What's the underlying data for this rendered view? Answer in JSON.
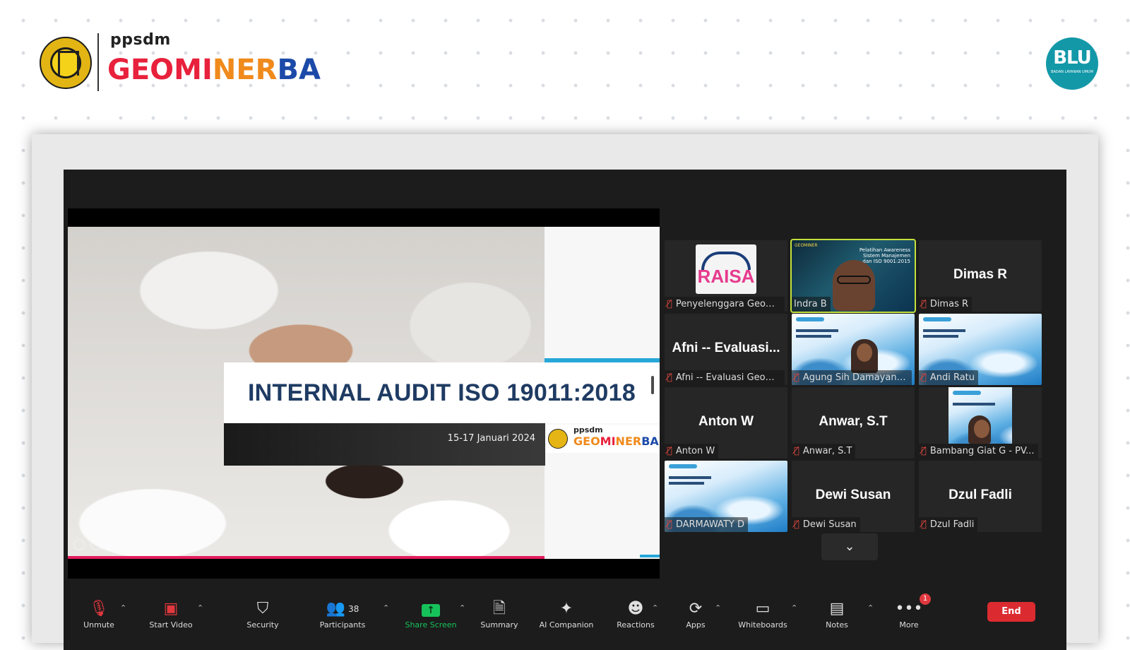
{
  "branding": {
    "brand_top": "ppsdm",
    "brand_main": {
      "geo": "GEO",
      "mi": "MI",
      "ner": "NER",
      "ba": "BA"
    },
    "badge_text": "BLU",
    "badge_sub": "BADAN LAYANAN UMUM"
  },
  "slide": {
    "title": "INTERNAL AUDIT  ISO 19011:2018",
    "date": "15-17 Januari 2024",
    "logo_top": "ppsdm",
    "logo_geo": "GEO",
    "logo_mi": "MI",
    "logo_ner": "NER",
    "logo_ba": "BA"
  },
  "gallery": {
    "tiles": [
      {
        "name": "Penyelenggara Geomi...",
        "center": "",
        "kind": "logo",
        "logo_text": "RAISA"
      },
      {
        "name": "Indra B",
        "center": "",
        "kind": "video",
        "active": true,
        "overlay": "Pelatihan Awareness Sistem Manajemen dan ISO 9001:2015",
        "tag": "GEOMINER"
      },
      {
        "name": "Dimas R",
        "center": "Dimas R",
        "kind": "name"
      },
      {
        "name": "Afni -- Evaluasi Geomin",
        "center": "Afni  -- Evaluasi...",
        "kind": "name"
      },
      {
        "name": "Agung Sih Damayanti-...",
        "center": "",
        "kind": "ppt-person"
      },
      {
        "name": "Andi Ratu",
        "center": "",
        "kind": "ppt"
      },
      {
        "name": "Anton W",
        "center": "Anton W",
        "kind": "name"
      },
      {
        "name": "Anwar, S.T",
        "center": "Anwar, S.T",
        "kind": "name"
      },
      {
        "name": "Bambang Giat G - PV...",
        "center": "",
        "kind": "small-ppt-person"
      },
      {
        "name": "DARMAWATY D",
        "center": "",
        "kind": "ppt"
      },
      {
        "name": "Dewi Susan",
        "center": "Dewi Susan",
        "kind": "name"
      },
      {
        "name": "Dzul Fadli",
        "center": "Dzul Fadli",
        "kind": "name"
      }
    ],
    "toggle_icon": "chevron-down-icon"
  },
  "toolbar": {
    "items": [
      {
        "id": "unmute",
        "label": "Unmute",
        "icon": "mic-muted-icon"
      },
      {
        "id": "start-video",
        "label": "Start Video",
        "icon": "video-off-icon"
      },
      {
        "id": "security",
        "label": "Security",
        "icon": "shield-icon"
      },
      {
        "id": "participants",
        "label": "Participants",
        "icon": "people-icon",
        "count": "38"
      },
      {
        "id": "share-screen",
        "label": "Share Screen",
        "icon": "share-screen-icon"
      },
      {
        "id": "summary",
        "label": "Summary",
        "icon": "summary-icon"
      },
      {
        "id": "ai-companion",
        "label": "AI Companion",
        "icon": "sparkle-icon"
      },
      {
        "id": "reactions",
        "label": "Reactions",
        "icon": "emoji-icon"
      },
      {
        "id": "apps",
        "label": "Apps",
        "icon": "apps-icon"
      },
      {
        "id": "whiteboards",
        "label": "Whiteboards",
        "icon": "whiteboard-icon"
      },
      {
        "id": "notes",
        "label": "Notes",
        "icon": "notes-icon"
      },
      {
        "id": "more",
        "label": "More",
        "icon": "more-icon",
        "badge": "1"
      }
    ],
    "end_label": "End"
  },
  "colors": {
    "accent_green": "#16c35a",
    "end_red": "#db2b31",
    "active_speaker": "#c5e03a",
    "zoom_bg": "#1c1c1c"
  }
}
